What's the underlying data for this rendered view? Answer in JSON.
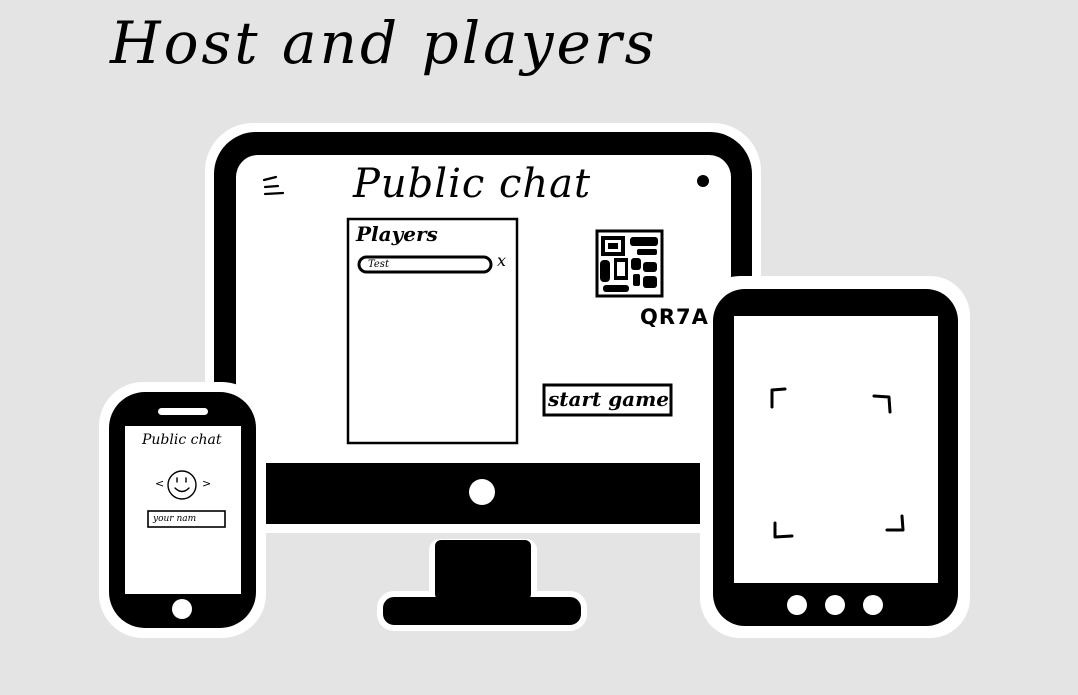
{
  "title": "Host and players",
  "desktop": {
    "chat_title": "Public chat",
    "players_panel": {
      "heading": "Players",
      "players": [
        {
          "name": "Test",
          "remove_label": "x"
        }
      ]
    },
    "room_code": "QR7A",
    "start_button": "start game"
  },
  "phone": {
    "chat_title": "Public chat",
    "avatar_prev": "<",
    "avatar_next": ">",
    "name_placeholder": "your nam"
  },
  "tablet": {
    "scanner": "qr-scan-frame-icon"
  },
  "colors": {
    "background": "#e4e4e4",
    "device": "#000000",
    "screen": "#ffffff"
  }
}
